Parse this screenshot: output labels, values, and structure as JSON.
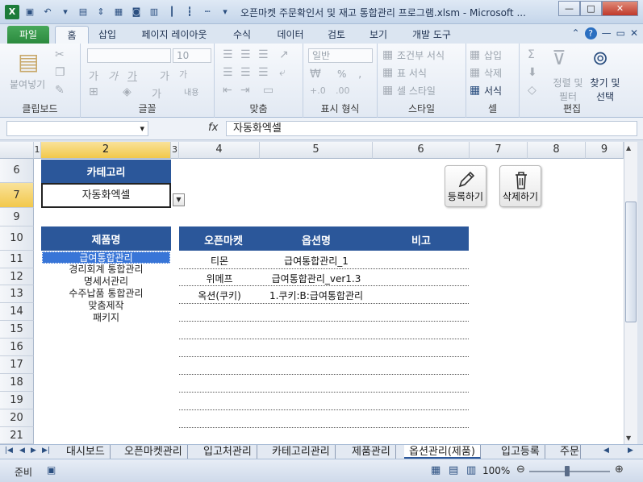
{
  "window": {
    "title": "오픈마켓 주문확인서 및 재고 통합관리 프로그램.xlsm - Microsoft ...",
    "minimize": "—",
    "maximize": "□",
    "close": "✕"
  },
  "ribbon_tabs": [
    "파일",
    "홈",
    "삽입",
    "페이지 레이아웃",
    "수식",
    "데이터",
    "검토",
    "보기",
    "개발 도구"
  ],
  "ribbon": {
    "groups": [
      "클립보드",
      "글꼴",
      "맞춤",
      "표시 형식",
      "스타일",
      "셀",
      "편집"
    ],
    "paste": "붙여넣기",
    "font_size": "10",
    "number_format": "일반",
    "conditional_format": "조건부 서식",
    "table_format": "표 서식",
    "cell_style": "셀 스타일",
    "insert": "삽입",
    "delete": "삭제",
    "format": "서식",
    "sort_filter": "정렬 및 필터",
    "find_select": "찾기 및 선택",
    "wrap": "내용",
    "percent": "%"
  },
  "formula_bar": {
    "fx": "fx",
    "value": "자동화엑셀"
  },
  "columns": [
    "1",
    "2",
    "3",
    "4",
    "5",
    "6",
    "7",
    "8",
    "9"
  ],
  "rows": [
    "6",
    "7",
    "9",
    "10",
    "11",
    "12",
    "13",
    "14",
    "15",
    "16",
    "17",
    "18",
    "19",
    "20",
    "21"
  ],
  "category": {
    "header": "카테고리",
    "value": "자동화엑셀"
  },
  "buttons": {
    "register": "등록하기",
    "delete": "삭제하기"
  },
  "products": {
    "header": "제품명",
    "items": [
      "급여통합관리",
      "경리회계 통합관리",
      "명세서관리",
      "수주납품 통합관리",
      "맞춤제작",
      "패키지"
    ]
  },
  "options_table": {
    "headers": [
      "오픈마켓",
      "옵션명",
      "비고"
    ],
    "rows": [
      [
        "티몬",
        "급여통합관리_1",
        ""
      ],
      [
        "위메프",
        "급여통합관리_ver1.3",
        ""
      ],
      [
        "옥션(쿠키)",
        "1.쿠키:B:급여통합관리",
        ""
      ]
    ]
  },
  "sheet_tabs": [
    "대시보드",
    "오픈마켓관리",
    "입고처관리",
    "카테고리관리",
    "제품관리",
    "옵션관리(제품)",
    "입고등록",
    "주문"
  ],
  "status": {
    "ready": "준비",
    "zoom": "100%"
  }
}
